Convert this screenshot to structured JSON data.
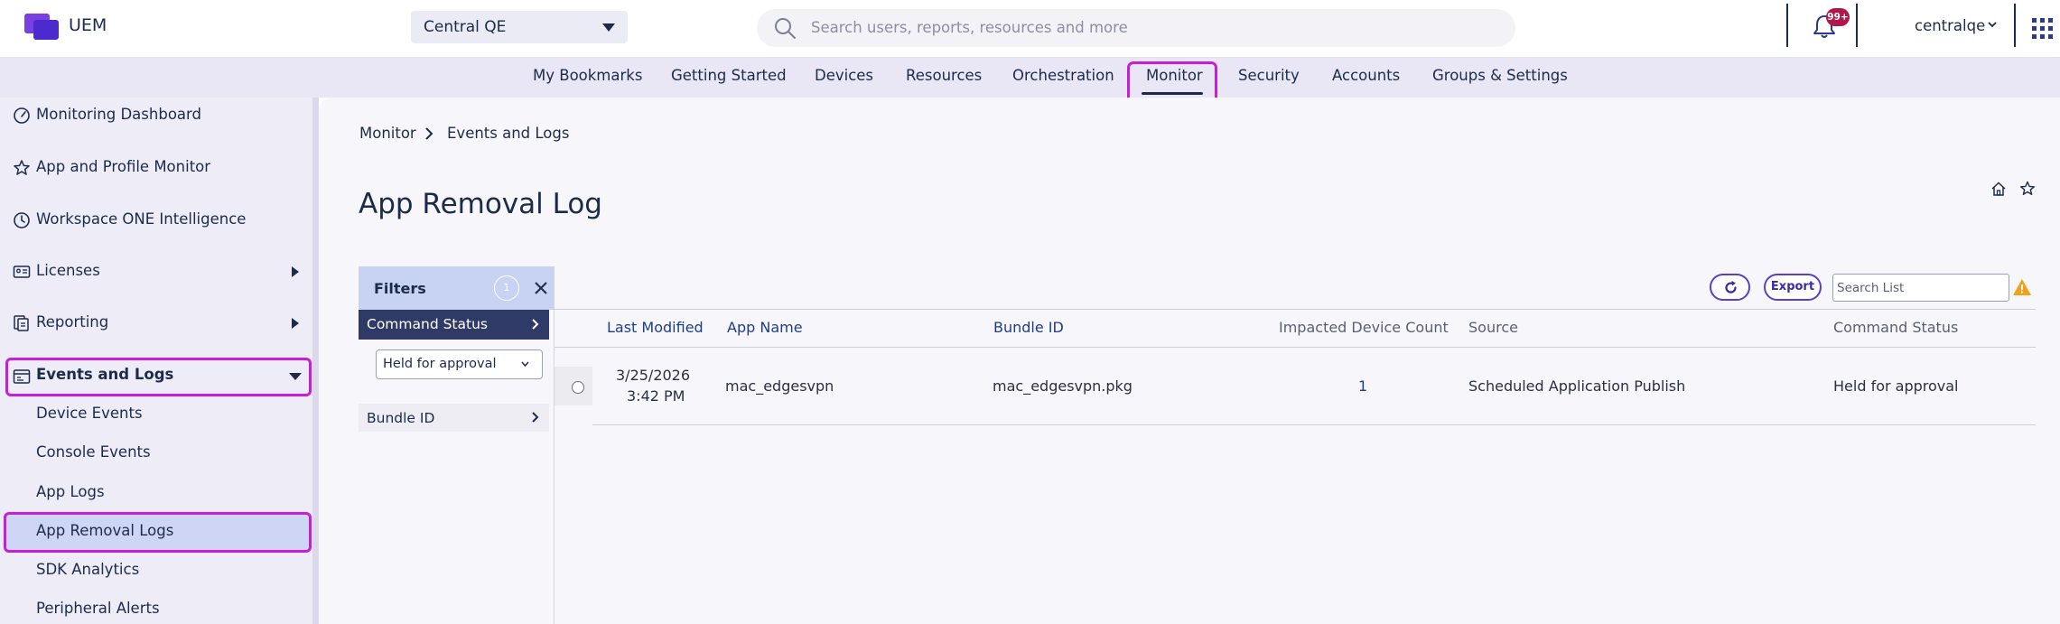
{
  "header": {
    "app_name": "UEM",
    "org_select": "Central QE",
    "search_placeholder": "Search users, reports, resources and more",
    "notification_badge": "99+",
    "user": "centralqe"
  },
  "nav": {
    "items": [
      "My Bookmarks",
      "Getting Started",
      "Devices",
      "Resources",
      "Orchestration",
      "Monitor",
      "Security",
      "Accounts",
      "Groups & Settings"
    ],
    "active": "Monitor"
  },
  "sidebar": {
    "items": [
      {
        "label": "Monitoring Dashboard",
        "icon": "gauge-icon"
      },
      {
        "label": "App and Profile Monitor",
        "icon": "star-outline-icon"
      },
      {
        "label": "Workspace ONE Intelligence",
        "icon": "clock-icon"
      },
      {
        "label": "Licenses",
        "icon": "id-card-icon"
      },
      {
        "label": "Reporting",
        "icon": "report-icon"
      },
      {
        "label": "Events and Logs",
        "icon": "log-window-icon"
      }
    ],
    "sub_items": [
      "Device Events",
      "Console Events",
      "App Logs",
      "App Removal Logs",
      "SDK Analytics",
      "Peripheral Alerts"
    ],
    "selected": "App Removal Logs"
  },
  "breadcrumb": {
    "root": "Monitor",
    "current": "Events and Logs"
  },
  "page": {
    "title": "App Removal Log"
  },
  "filters": {
    "title": "Filters",
    "count": "1",
    "active_filter": "Command Status",
    "active_value": "Held for approval",
    "other_filter": "Bundle ID"
  },
  "toolbar": {
    "export_label": "Export",
    "search_placeholder": "Search List"
  },
  "table": {
    "columns": [
      "Last Modified",
      "App Name",
      "Bundle ID",
      "Impacted Device Count",
      "Source",
      "Command Status"
    ],
    "rows": [
      {
        "last_modified_date": "3/25/2026",
        "last_modified_time": "3:42 PM",
        "app_name": "mac_edgesvpn",
        "bundle_id": "mac_edgesvpn.pkg",
        "impacted_device_count": "1",
        "source": "Scheduled Application Publish",
        "command_status": "Held for approval"
      }
    ]
  },
  "colors": {
    "accent": "#5a3fc8",
    "highlight": "#c71ed9",
    "nav_bg": "#e9e6f5",
    "primary_text": "#1c2b4a"
  }
}
